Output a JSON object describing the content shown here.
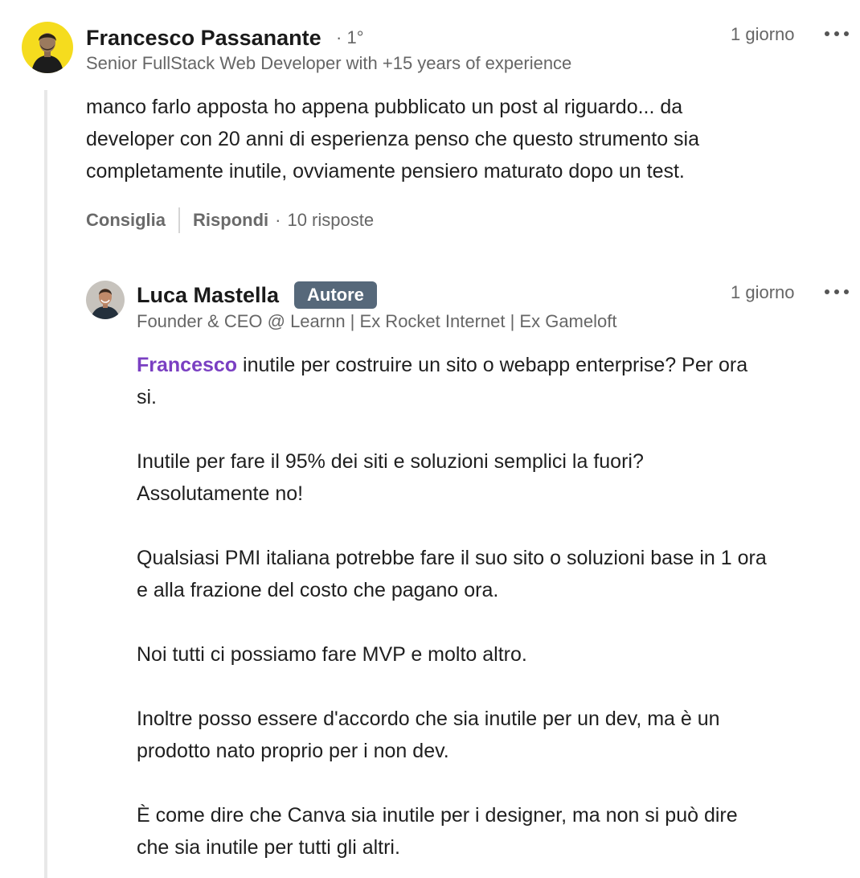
{
  "comment": {
    "author": "Francesco Passanante",
    "degree": "1°",
    "headline": "Senior FullStack Web Developer with +15 years of experience",
    "time": "1 giorno",
    "text_lines": [
      "manco farlo apposta ho appena pubblicato un post al riguardo... da",
      "developer con 20 anni di esperienza penso che questo strumento sia",
      "completamente inutile, ovviamente pensiero maturato dopo un test."
    ],
    "actions": {
      "like": "Consiglia",
      "reply": "Rispondi",
      "replies_count": "10 risposte"
    },
    "avatar_icon": "person-avatar-yellow"
  },
  "reply": {
    "author": "Luca Mastella",
    "badge": "Autore",
    "headline": "Founder & CEO @ Learnn | Ex Rocket Internet | Ex Gameloft",
    "time": "1 giorno",
    "mention": "Francesco",
    "first_line_rest": " inutile per costruire un sito o webapp enterprise? Per ora",
    "first_line_wrap": "si.",
    "paragraphs": [
      [
        "Inutile per fare il 95% dei siti e soluzioni semplici la fuori?",
        "Assolutamente no!"
      ],
      [
        "Qualsiasi PMI italiana potrebbe fare il suo sito o soluzioni base in 1 ora",
        "e alla frazione del costo che pagano ora."
      ],
      [
        "Noi tutti ci possiamo fare MVP e molto altro."
      ],
      [
        "Inoltre posso essere d'accordo che sia inutile per un dev, ma è un",
        "prodotto nato proprio per i non dev."
      ],
      [
        "È come dire che Canva sia inutile per i designer, ma non si può dire",
        "che sia inutile per tutti gli altri."
      ]
    ],
    "avatar_icon": "person-avatar-photo"
  },
  "colors": {
    "badge_bg": "#56687a",
    "mention": "#7a3fc2",
    "thread_line": "#e8e8e8",
    "avatar_yellow": "#f5dc1e"
  }
}
